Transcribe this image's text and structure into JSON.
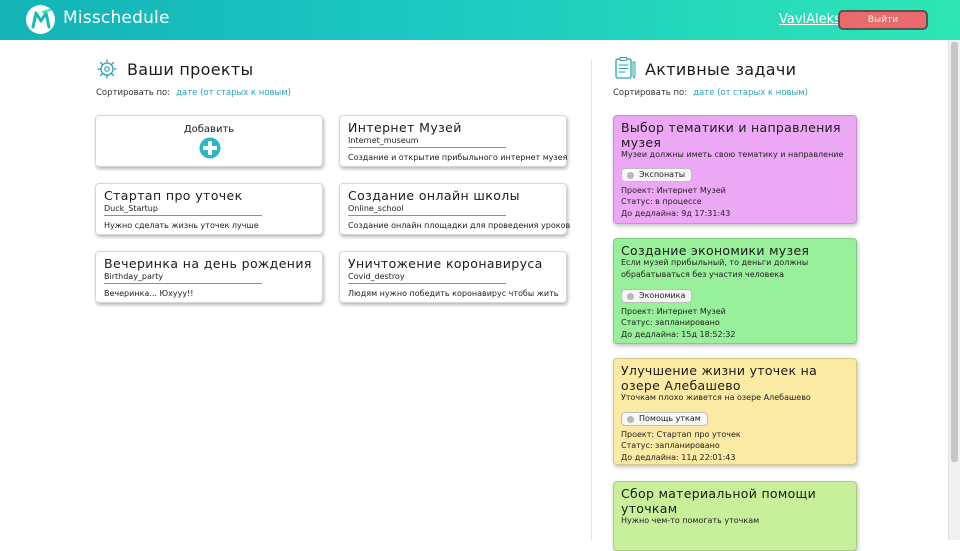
{
  "header": {
    "app_name": "Misschedule",
    "user_name": "VavlAleks",
    "logout_label": "Выйти",
    "gradient": [
      "#13b3b6",
      "#2ee6b4"
    ]
  },
  "projects_section": {
    "title": "Ваши проекты",
    "sort_label": "Сортировать по:",
    "sort_value": "дате (от старых к новым)",
    "add_label": "Добавить",
    "cards": [
      {
        "title": "Интернет Музей",
        "code": "Internet_museum",
        "desc": "Создание и открытие прибыльного интернет музея"
      },
      {
        "title": "Стартап про уточек",
        "code": "Duck_Startup",
        "desc": "Нужно сделать жизнь уточек лучше"
      },
      {
        "title": "Создание онлайн школы",
        "code": "Online_school",
        "desc": "Создание онлайн площадки для проведения уроков"
      },
      {
        "title": "Вечеринка на день рождения",
        "code": "Birthday_party",
        "desc": "Вечеринка... Юхууу!!"
      },
      {
        "title": "Уничтожение коронавируса",
        "code": "Covid_destroy",
        "desc": "Людям нужно победить коронавирус чтобы жить"
      }
    ]
  },
  "tasks_section": {
    "title": "Активные задачи",
    "sort_label": "Сортировать по:",
    "sort_value": "дате (от старых к новым)",
    "tasks": [
      {
        "title": "Выбор тематики и направления музея",
        "desc": "Музеи должны иметь свою тематику и направление",
        "tag": "Экспонаты",
        "project": "Проект: Интернет Музей",
        "status": "Статус: в процессе",
        "deadline": "До дедлайна: 9д 17:31:43",
        "color": "#eda8f5"
      },
      {
        "title": "Создание экономики музея",
        "desc": "Если музей прибыльный, то деньги должны обрабатываться без участия человека",
        "tag": "Экономика",
        "project": "Проект: Интернет Музей",
        "status": "Статус: запланировано",
        "deadline": "До дедлайна: 15д 18:52:32",
        "color": "#98f09a"
      },
      {
        "title": "Улучшение жизни уточек на озере Алебашево",
        "desc": "Уточкам плохо живется на озере Алебашево",
        "tag": "Помощь уткам",
        "project": "Проект: Стартап про уточек",
        "status": "Статус: запланировано",
        "deadline": "До дедлайна: 11д 22:01:43",
        "color": "#fbeaa3"
      },
      {
        "title": "Сбор материальной помощи уточкам",
        "desc": "Нужно чем-то помогать уточкам",
        "color": "#c8ef9a"
      }
    ]
  }
}
